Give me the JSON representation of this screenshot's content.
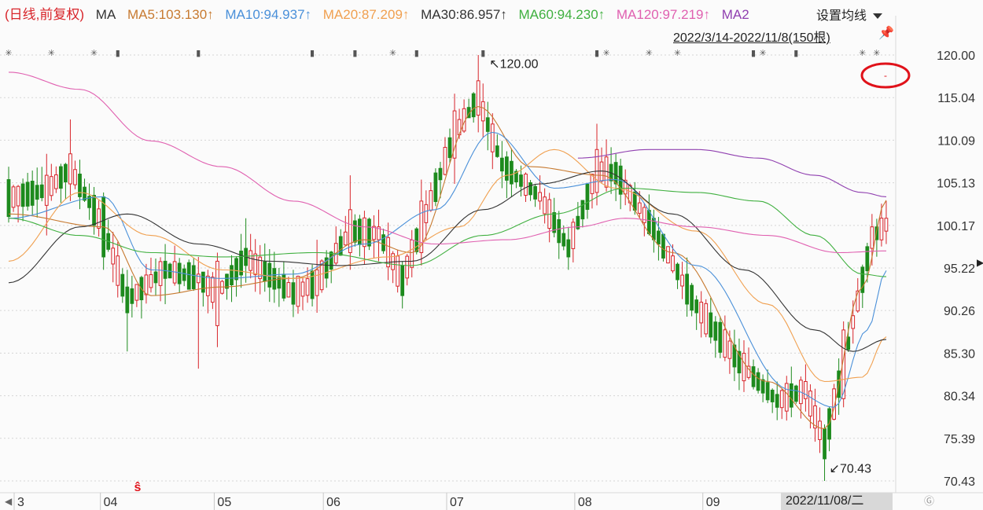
{
  "header": {
    "mode": "(日线,前复权)",
    "ma_label": "MA",
    "ma5": "MA5:103.130↑",
    "ma10": "MA10:94.937↑",
    "ma20": "MA20:87.209↑",
    "ma30": "MA30:86.957↑",
    "ma60": "MA60:94.230↑",
    "ma120": "MA120:97.219↑",
    "ma250": "MA2"
  },
  "controls": {
    "set_ma_label": "设置均线",
    "range_label": "2022/3/14-2022/11/8(150根)"
  },
  "colors": {
    "up": "#d8242a",
    "down": "#1d8a1d",
    "ma5": "#c77a30",
    "ma10": "#4a90d9",
    "ma20": "#f0a050",
    "ma30": "#333333",
    "ma60": "#40b040",
    "ma120": "#e060b0",
    "ma250": "#9040b0",
    "header_mode": "#d8242a"
  },
  "chart_data": {
    "type": "candlestick",
    "ylim": [
      70.43,
      120.0
    ],
    "y_ticks": [
      "120.00",
      "115.04",
      "110.09",
      "105.13",
      "100.17",
      "95.22",
      "90.26",
      "85.30",
      "80.34",
      "75.39",
      "70.43"
    ],
    "x_ticks": [
      "3",
      "04",
      "05",
      "06",
      "07",
      "08",
      "09"
    ],
    "annotations": {
      "high": "120.00",
      "low": "70.43",
      "selected_date": "2022/11/08/二"
    },
    "ohlc_keypoints": [
      {
        "i": 0,
        "o": 105.5,
        "c": 101.2,
        "h": 107.0,
        "l": 100.5
      },
      {
        "i": 8,
        "o": 102.5,
        "c": 106.0,
        "h": 108.5,
        "l": 99.0
      },
      {
        "i": 13,
        "o": 105.0,
        "c": 108.5,
        "h": 112.5,
        "l": 103.0
      },
      {
        "i": 20,
        "o": 103.5,
        "c": 96.5,
        "h": 104.0,
        "l": 95.0
      },
      {
        "i": 25,
        "o": 93.0,
        "c": 90.0,
        "h": 95.0,
        "l": 85.5
      },
      {
        "i": 33,
        "o": 96.0,
        "c": 94.0,
        "h": 98.0,
        "l": 91.0
      },
      {
        "i": 40,
        "o": 93.5,
        "c": 94.5,
        "h": 96.5,
        "l": 83.5
      },
      {
        "i": 44,
        "o": 88.5,
        "c": 96.0,
        "h": 97.0,
        "l": 86.0
      },
      {
        "i": 50,
        "o": 97.5,
        "c": 95.5,
        "h": 101.0,
        "l": 93.5
      },
      {
        "i": 60,
        "o": 93.5,
        "c": 91.0,
        "h": 95.0,
        "l": 89.5
      },
      {
        "i": 65,
        "o": 92.0,
        "c": 95.0,
        "h": 98.5,
        "l": 90.0
      },
      {
        "i": 72,
        "o": 97.0,
        "c": 102.0,
        "h": 106.0,
        "l": 95.0
      },
      {
        "i": 78,
        "o": 98.5,
        "c": 100.0,
        "h": 102.0,
        "l": 96.0
      },
      {
        "i": 83,
        "o": 95.5,
        "c": 92.0,
        "h": 96.0,
        "l": 90.5
      },
      {
        "i": 87,
        "o": 97.0,
        "c": 103.0,
        "h": 105.5,
        "l": 95.5
      },
      {
        "i": 94,
        "o": 108.0,
        "c": 113.5,
        "h": 115.5,
        "l": 105.0
      },
      {
        "i": 99,
        "o": 113.0,
        "c": 117.0,
        "h": 120.0,
        "l": 111.0
      },
      {
        "i": 104,
        "o": 108.0,
        "c": 106.5,
        "h": 110.0,
        "l": 104.5
      },
      {
        "i": 112,
        "o": 103.0,
        "c": 104.0,
        "h": 106.0,
        "l": 102.0
      },
      {
        "i": 118,
        "o": 98.5,
        "c": 96.5,
        "h": 100.0,
        "l": 95.0
      },
      {
        "i": 124,
        "o": 104.0,
        "c": 109.0,
        "h": 112.0,
        "l": 102.5
      },
      {
        "i": 128,
        "o": 107.5,
        "c": 105.0,
        "h": 108.5,
        "l": 103.0
      },
      {
        "i": 136,
        "o": 101.0,
        "c": 98.5,
        "h": 102.0,
        "l": 97.0
      },
      {
        "i": 145,
        "o": 91.5,
        "c": 90.0,
        "h": 92.0,
        "l": 88.0
      },
      {
        "i": 154,
        "o": 85.5,
        "c": 83.0,
        "h": 87.0,
        "l": 81.0
      },
      {
        "i": 162,
        "o": 80.5,
        "c": 79.0,
        "h": 82.0,
        "l": 77.5
      },
      {
        "i": 168,
        "o": 80.0,
        "c": 82.0,
        "h": 84.0,
        "l": 78.5
      },
      {
        "i": 172,
        "o": 76.5,
        "c": 73.0,
        "h": 77.0,
        "l": 70.43
      },
      {
        "i": 176,
        "o": 80.0,
        "c": 88.0,
        "h": 89.0,
        "l": 79.0
      },
      {
        "i": 182,
        "o": 97.5,
        "c": 100.0,
        "h": 101.5,
        "l": 95.5
      },
      {
        "i": 185,
        "o": 99.5,
        "c": 101.0,
        "h": 103.0,
        "l": 98.0
      }
    ],
    "ma_keypoints": {
      "ma5": [
        [
          0,
          101.5
        ],
        [
          20,
          100.0
        ],
        [
          30,
          92.0
        ],
        [
          45,
          93.0
        ],
        [
          60,
          94.0
        ],
        [
          75,
          98.5
        ],
        [
          85,
          97.0
        ],
        [
          99,
          114.0
        ],
        [
          110,
          107.0
        ],
        [
          125,
          106.0
        ],
        [
          140,
          97.0
        ],
        [
          160,
          82.0
        ],
        [
          172,
          76.5
        ],
        [
          180,
          93.0
        ],
        [
          185,
          103.1
        ]
      ],
      "ma10": [
        [
          0,
          101.0
        ],
        [
          20,
          103.5
        ],
        [
          30,
          95.0
        ],
        [
          45,
          94.0
        ],
        [
          60,
          94.5
        ],
        [
          75,
          98.0
        ],
        [
          90,
          102.0
        ],
        [
          102,
          111.0
        ],
        [
          115,
          104.5
        ],
        [
          128,
          105.5
        ],
        [
          145,
          95.5
        ],
        [
          165,
          81.0
        ],
        [
          174,
          79.0
        ],
        [
          181,
          88.0
        ],
        [
          185,
          94.9
        ]
      ],
      "ma20": [
        [
          0,
          96.0
        ],
        [
          15,
          104.0
        ],
        [
          30,
          99.0
        ],
        [
          45,
          95.0
        ],
        [
          60,
          94.0
        ],
        [
          80,
          96.5
        ],
        [
          95,
          100.0
        ],
        [
          105,
          106.0
        ],
        [
          115,
          109.0
        ],
        [
          128,
          104.5
        ],
        [
          145,
          99.5
        ],
        [
          160,
          91.0
        ],
        [
          172,
          82.0
        ],
        [
          180,
          82.5
        ],
        [
          185,
          87.2
        ]
      ],
      "ma30": [
        [
          0,
          93.5
        ],
        [
          15,
          100.0
        ],
        [
          25,
          101.5
        ],
        [
          40,
          98.0
        ],
        [
          55,
          96.0
        ],
        [
          70,
          95.5
        ],
        [
          85,
          96.0
        ],
        [
          100,
          102.0
        ],
        [
          112,
          105.0
        ],
        [
          125,
          106.5
        ],
        [
          140,
          101.5
        ],
        [
          155,
          95.0
        ],
        [
          170,
          88.0
        ],
        [
          178,
          85.5
        ],
        [
          185,
          86.9
        ]
      ],
      "ma60": [
        [
          0,
          101.0
        ],
        [
          15,
          99.0
        ],
        [
          30,
          97.0
        ],
        [
          45,
          96.5
        ],
        [
          65,
          97.0
        ],
        [
          85,
          95.5
        ],
        [
          100,
          99.0
        ],
        [
          115,
          101.5
        ],
        [
          130,
          104.5
        ],
        [
          145,
          104.0
        ],
        [
          158,
          103.0
        ],
        [
          170,
          99.0
        ],
        [
          180,
          94.5
        ],
        [
          185,
          94.2
        ]
      ],
      "ma120": [
        [
          0,
          118.0
        ],
        [
          15,
          116.0
        ],
        [
          30,
          110.0
        ],
        [
          45,
          107.0
        ],
        [
          60,
          103.0
        ],
        [
          75,
          100.0
        ],
        [
          90,
          98.0
        ],
        [
          105,
          98.5
        ],
        [
          120,
          100.0
        ],
        [
          130,
          101.0
        ],
        [
          145,
          100.0
        ],
        [
          160,
          99.0
        ],
        [
          175,
          97.0
        ],
        [
          185,
          97.2
        ]
      ],
      "ma250": [
        [
          120,
          108.0
        ],
        [
          135,
          109.0
        ],
        [
          145,
          109.0
        ],
        [
          158,
          108.0
        ],
        [
          170,
          106.0
        ],
        [
          180,
          104.0
        ],
        [
          185,
          103.5
        ]
      ]
    }
  }
}
